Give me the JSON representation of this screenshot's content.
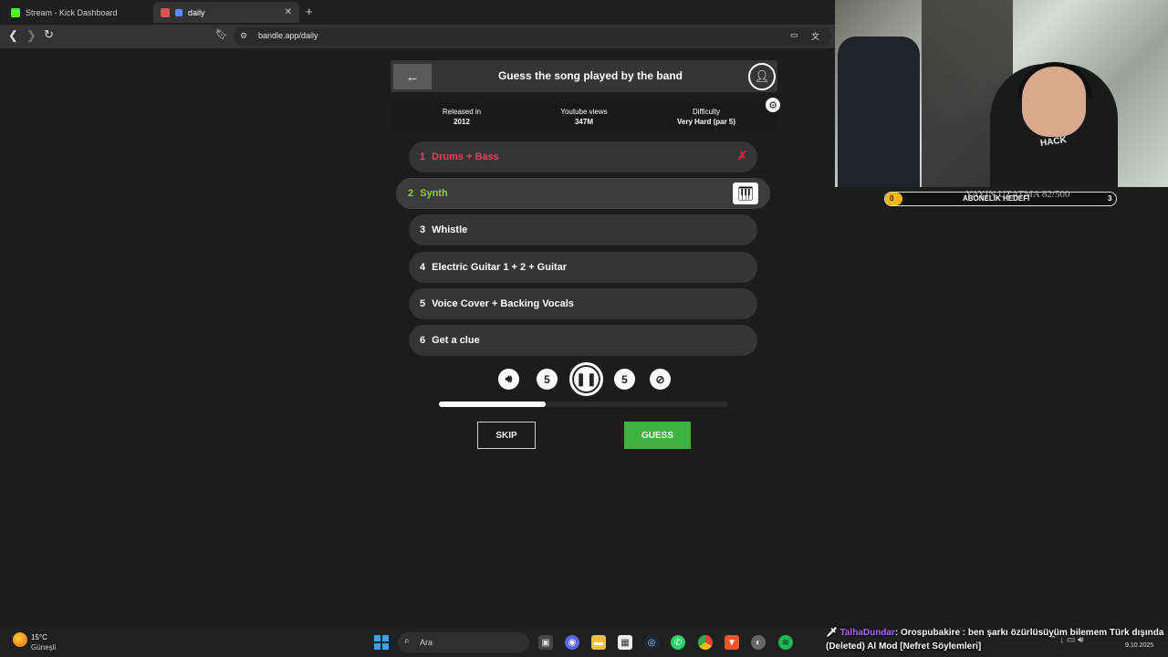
{
  "browser": {
    "tabs": [
      {
        "label": "Stream - Kick Dashboard",
        "active": false
      },
      {
        "label": "daily",
        "active": true
      }
    ],
    "url": "bandle.app/daily"
  },
  "game": {
    "title": "Guess the song played by the band",
    "info": [
      {
        "label": "Released in",
        "value": "2012"
      },
      {
        "label": "Youtube views",
        "value": "347M"
      },
      {
        "label": "Difficulty",
        "value": "Very Hard (par 5)"
      }
    ],
    "stems": [
      {
        "num": "1",
        "label": "Drums + Bass",
        "state": "failed"
      },
      {
        "num": "2",
        "label": "Synth",
        "state": "current"
      },
      {
        "num": "3",
        "label": "Whistle",
        "state": "locked"
      },
      {
        "num": "4",
        "label": "Electric Guitar 1 + 2 + Guitar",
        "state": "locked"
      },
      {
        "num": "5",
        "label": "Voice Cover + Backing Vocals",
        "state": "locked"
      },
      {
        "num": "6",
        "label": "Get a clue",
        "state": "locked"
      }
    ],
    "controls": [
      "volume-icon",
      "rewind-5-icon",
      "pause-icon",
      "forward-5-icon",
      "no-repeat-icon"
    ],
    "rewind_label": "5",
    "forward_label": "5",
    "progress": 0.37,
    "skip_label": "SKIP",
    "guess_label": "GUESS",
    "colors": {
      "failed": "#e0445a",
      "current": "#8ad13e",
      "guess": "#3cb33c"
    }
  },
  "overlay": {
    "subgoal_label": "ABONELİK HEDEFİ",
    "subgoal_low": "0",
    "subgoal_high": "3",
    "ghost_text": "YAYIN UZATMA 82/500",
    "shirt_text": "HACK"
  },
  "chat": {
    "user": "TalhaDundar",
    "message": ": Orospubakire : ben şarkı özürlüsüyüm bilemem Türk dışında (Deleted) Al Mod [Nefret Söylemleri]"
  },
  "taskbar": {
    "weather_temp": "15°C",
    "weather_desc": "Güneşli",
    "search_placeholder": "Ara",
    "date": "9.10.2025"
  }
}
